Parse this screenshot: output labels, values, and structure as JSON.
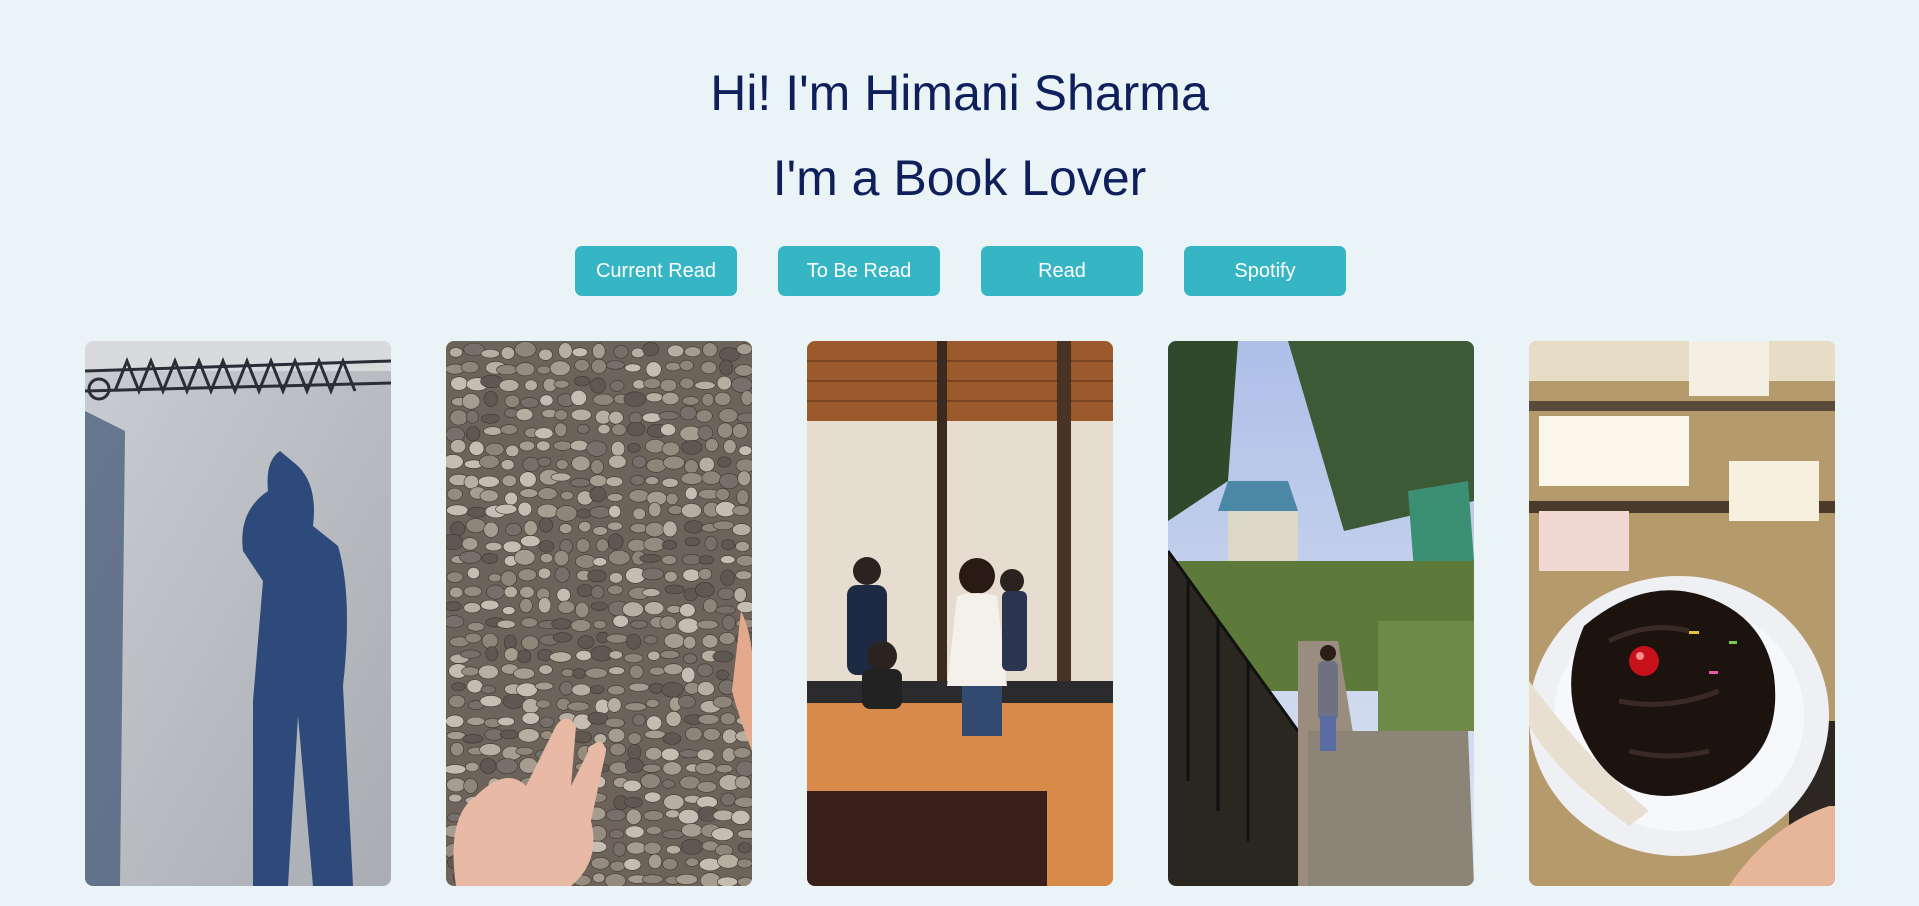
{
  "hero": {
    "greeting": "Hi! I'm Himani Sharma",
    "tagline": "I'm a Book Lover"
  },
  "nav": {
    "buttons": [
      {
        "label": "Current Read"
      },
      {
        "label": "To Be Read"
      },
      {
        "label": "Read"
      },
      {
        "label": "Spotify"
      }
    ]
  },
  "gallery": {
    "photos": [
      {
        "subject": "shadow-on-pavement"
      },
      {
        "subject": "pebbles-in-hand"
      },
      {
        "subject": "mirror-selfie-cafe"
      },
      {
        "subject": "hill-stairs-path"
      },
      {
        "subject": "chocolate-cupcake"
      }
    ]
  },
  "colors": {
    "background": "#eaf4f7",
    "heading": "#0f1f5c",
    "button": "#36b5c4",
    "button_text": "#ffffff"
  }
}
